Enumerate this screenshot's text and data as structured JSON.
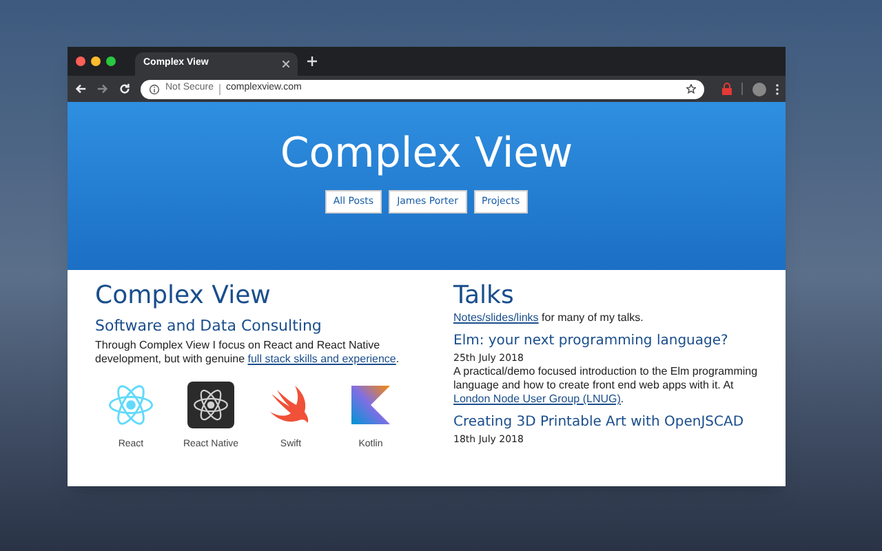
{
  "browser": {
    "tab": {
      "title": "Complex View",
      "selected": true
    },
    "address": {
      "security": "Not Secure",
      "url": "complexview.com"
    }
  },
  "hero": {
    "title": "Complex View",
    "nav": [
      {
        "label": "All Posts"
      },
      {
        "label": "James Porter"
      },
      {
        "label": "Projects"
      }
    ]
  },
  "left": {
    "title": "Complex View",
    "subtitle": "Software and Data Consulting",
    "intro": [
      {
        "text": "Through Complex View I focus on React and React Native development, but with genuine ",
        "link": false
      },
      {
        "text": "full stack skills and experience",
        "link": true
      },
      {
        "text": ".",
        "link": false
      }
    ],
    "skills": [
      {
        "kind": "react",
        "label": "React"
      },
      {
        "kind": "react-native",
        "label": "React Native"
      },
      {
        "kind": "swift",
        "label": "Swift"
      },
      {
        "kind": "kotlin",
        "label": "Kotlin"
      }
    ]
  },
  "right": {
    "title": "Talks",
    "intro": [
      {
        "text": "Notes/slides/links",
        "link": true
      },
      {
        "text": " for many of my talks.",
        "link": false
      }
    ],
    "talks": [
      {
        "title": "Elm: your next programming language?",
        "date": "25th July 2018",
        "body": [
          {
            "text": "A practical/demo focused introduction to the Elm programming language and how to create front end web apps with it. At ",
            "link": false
          },
          {
            "text": "London Node User Group (LNUG)",
            "link": true
          },
          {
            "text": ".",
            "link": false
          }
        ]
      },
      {
        "title": "Creating 3D Printable Art with OpenJSCAD",
        "date": "18th July 2018"
      }
    ]
  }
}
